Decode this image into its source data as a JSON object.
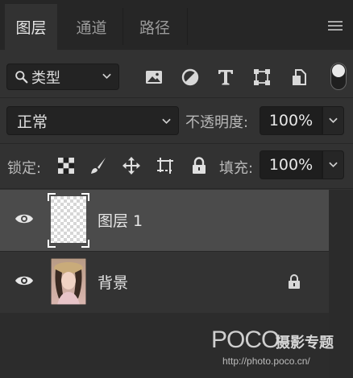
{
  "tabs": [
    {
      "label": "图层",
      "active": true
    },
    {
      "label": "通道",
      "active": false
    },
    {
      "label": "路径",
      "active": false
    }
  ],
  "filter": {
    "kind_label": "类型",
    "icons": [
      "image-filter-icon",
      "adjustment-filter-icon",
      "type-filter-icon",
      "shape-filter-icon",
      "smart-object-filter-icon"
    ]
  },
  "blend": {
    "mode": "正常",
    "opacity_label": "不透明度:",
    "opacity_value": "100%"
  },
  "lock_row": {
    "label": "锁定:",
    "fill_label": "填充:",
    "fill_value": "100%"
  },
  "layers": [
    {
      "name": "图层 1",
      "selected": true,
      "visible": true,
      "locked": false
    },
    {
      "name": "背景",
      "selected": false,
      "visible": true,
      "locked": true
    }
  ],
  "watermark": {
    "logo": "POCO",
    "cn": "摄影专题",
    "url": "http://photo.poco.cn/"
  },
  "colors": {
    "panel_bg": "#323232",
    "selected_row": "#4b4b4b",
    "field_bg": "#232323"
  }
}
